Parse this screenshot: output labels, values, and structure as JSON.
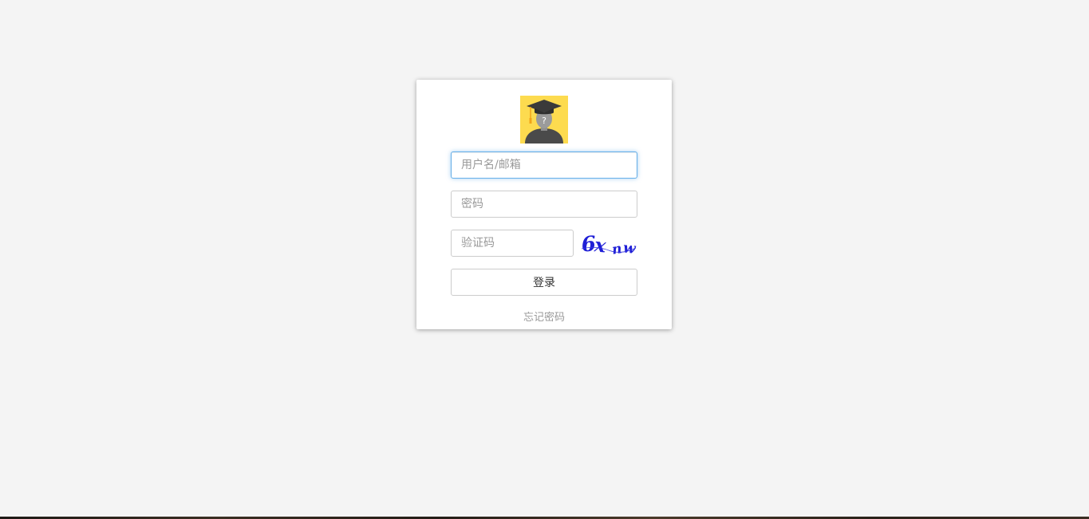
{
  "login": {
    "username_placeholder": "用户名/邮箱",
    "password_placeholder": "密码",
    "captcha_placeholder": "验证码",
    "captcha_text": "6x nw",
    "login_label": "登录",
    "forgot_label": "忘记密码"
  },
  "colors": {
    "background": "#f4f4f4",
    "avatar_bg": "#fddb4f",
    "captcha_text": "#1f1fd6",
    "focus_border": "#66afe9"
  },
  "icons": {
    "avatar": "graduate-avatar-icon"
  }
}
